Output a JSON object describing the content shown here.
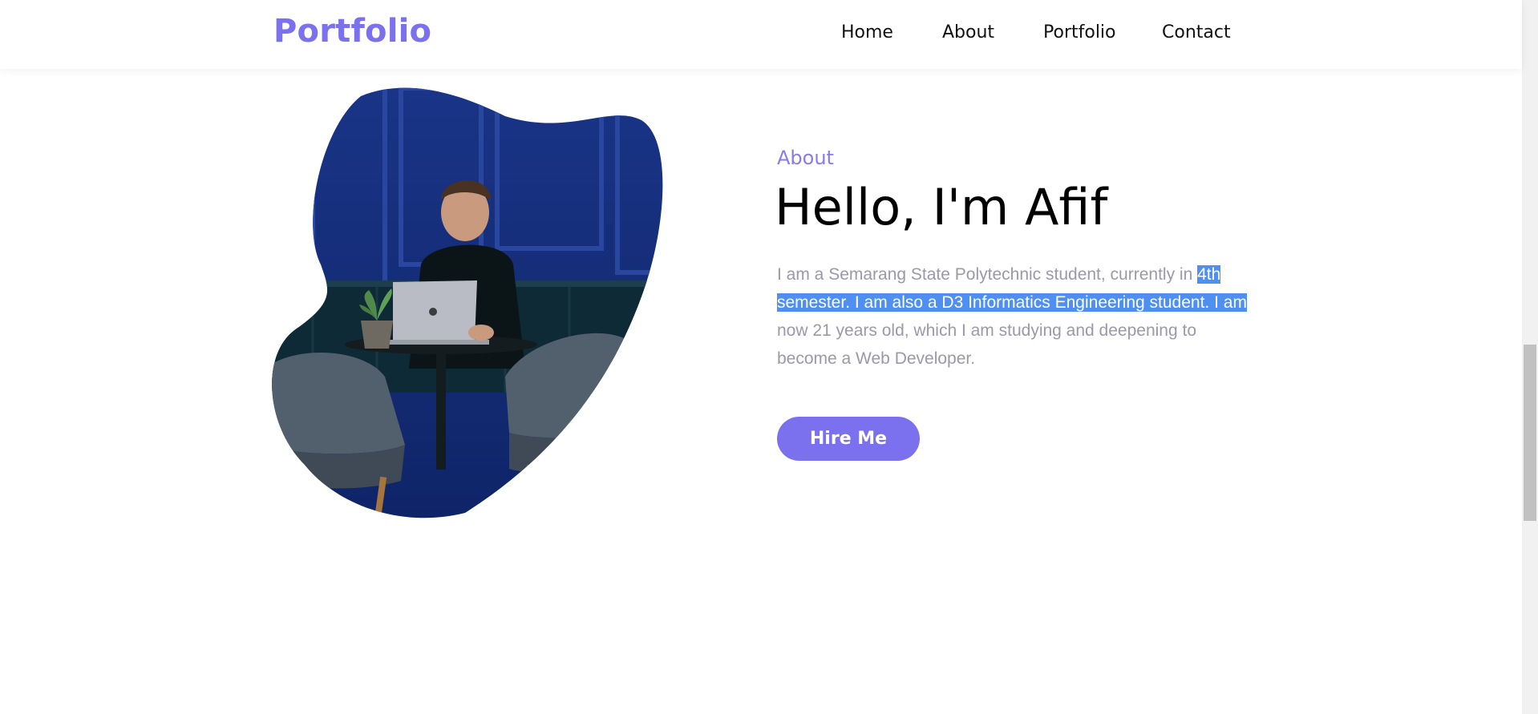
{
  "navbar": {
    "logo": "Portfolio",
    "links": [
      "Home",
      "About",
      "Portfolio",
      "Contact"
    ]
  },
  "about": {
    "section_label": "About",
    "title": "Hello, I'm Afif",
    "bio_plain_1": "I am a Semarang State Polytechnic student, currently in ",
    "bio_selected": "4th semester. I am also a D3 Informatics Engineering student. I am",
    "bio_plain_2": " now 21 years old, which I am studying and deepening to become a Web Developer.",
    "hire_button": "Hire Me"
  },
  "colors": {
    "accent": "#7b70ee",
    "text_muted": "#9b98a8",
    "selection": "#4f8ff2"
  },
  "icons": {
    "profile_photo": "person-with-laptop-photo"
  }
}
